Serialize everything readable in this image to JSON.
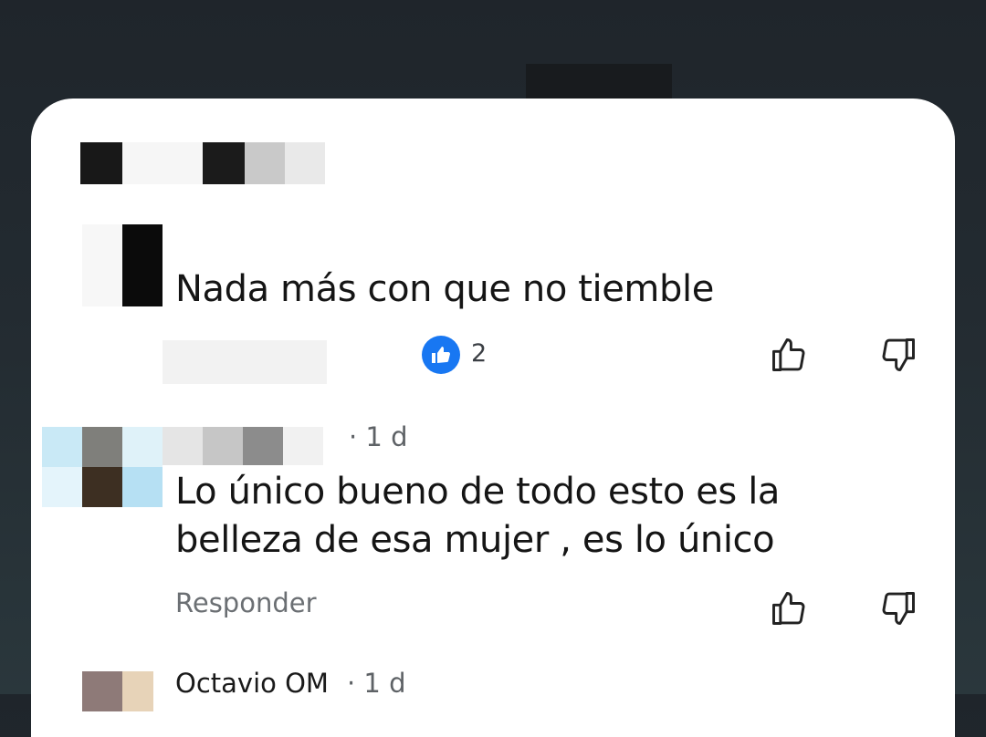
{
  "comments": [
    {
      "text": "Nada más con que no tiemble",
      "reaction_count": "2",
      "icons": {
        "reaction": "blue-like-badge",
        "like": "thumb-up-icon",
        "dislike": "thumb-down-icon"
      }
    },
    {
      "time": "· 1 d",
      "text_line1": "Lo único bueno de todo esto es la",
      "text_line2": "belleza de esa mujer , es lo único",
      "reply_label": "Responder",
      "icons": {
        "like": "thumb-up-icon",
        "dislike": "thumb-down-icon"
      }
    },
    {
      "author": "Octavio OM",
      "time": "· 1 d"
    }
  ],
  "colors": {
    "like_badge": "#1877f2",
    "card": "#ffffff",
    "background": "#1f252b"
  }
}
